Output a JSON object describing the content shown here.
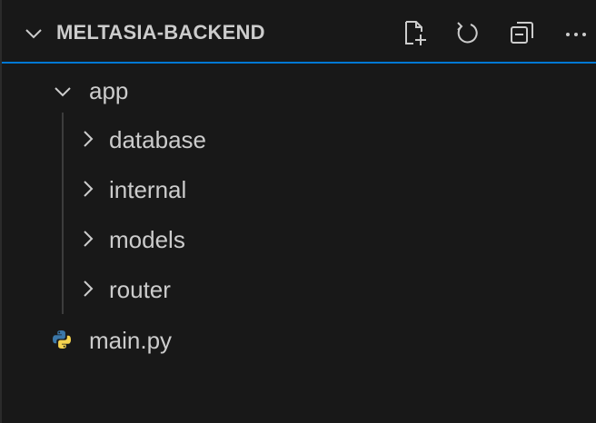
{
  "explorer": {
    "title": "MELTASIA-BACKEND",
    "actions": [
      {
        "name": "new-file",
        "icon": "new-file-icon"
      },
      {
        "name": "refresh",
        "icon": "refresh-icon"
      },
      {
        "name": "collapse-all",
        "icon": "collapse-all-icon"
      },
      {
        "name": "more",
        "icon": "more-icon"
      }
    ],
    "tree": {
      "root_folder": "app",
      "subfolders": [
        "database",
        "internal",
        "models",
        "router"
      ],
      "file": "main.py"
    }
  },
  "colors": {
    "background": "#181818",
    "text": "#cccccc",
    "focus_border": "#0078d4",
    "python_icon_blue": "#3b77a8",
    "python_icon_yellow": "#f5d34f"
  }
}
